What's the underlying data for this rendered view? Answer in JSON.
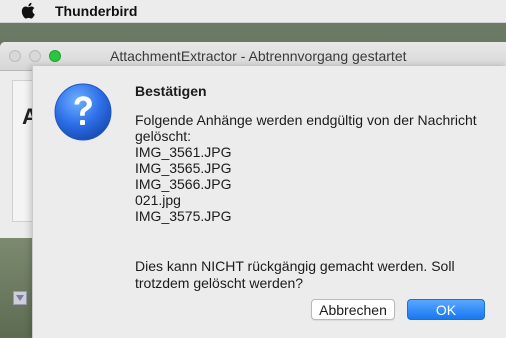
{
  "menubar": {
    "app_name": "Thunderbird"
  },
  "parent_window": {
    "title": "AttachmentExtractor - Abtrennvorgang gestartet",
    "ghost_letter": "A"
  },
  "dialog": {
    "title": "Bestätigen",
    "message_line": "Folgende Anhänge werden endgültig von der Nachricht gelöscht:",
    "files": [
      "IMG_3561.JPG",
      "IMG_3565.JPG",
      "IMG_3566.JPG",
      "021.jpg",
      "IMG_3575.JPG"
    ],
    "warning": "Dies kann NICHT rückgängig gemacht werden. Soll trotzdem gelöscht werden?",
    "cancel_label": "Abbrechen",
    "ok_label": "OK",
    "icon": "question-icon"
  },
  "colors": {
    "ok_button": "#1778f2",
    "question_icon": "#2d6fe8"
  }
}
